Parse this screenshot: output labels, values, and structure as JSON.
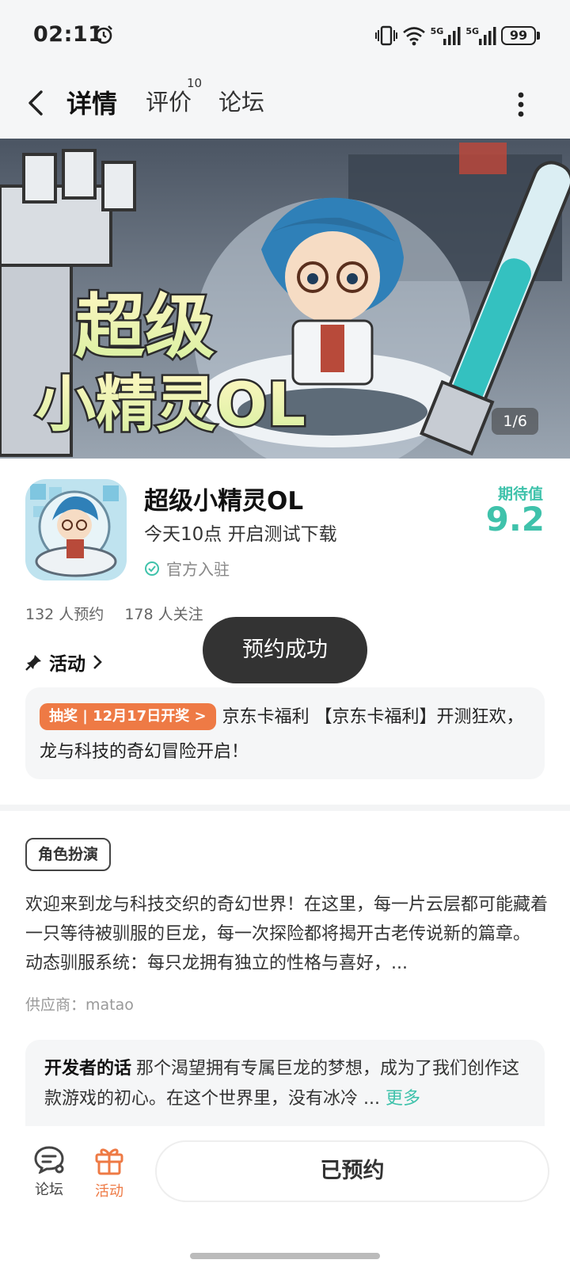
{
  "status_bar": {
    "time": "02:11",
    "network_label_1": "5G",
    "network_label_2": "5G",
    "battery": "99"
  },
  "nav": {
    "tabs": [
      {
        "label": "详情",
        "active": true
      },
      {
        "label": "评价",
        "badge": "10"
      },
      {
        "label": "论坛"
      }
    ]
  },
  "banner": {
    "title_line1": "超级",
    "title_line2": "小精灵OL",
    "counter": "1/6"
  },
  "app": {
    "name": "超级小精灵OL",
    "subtitle": "今天10点 开启测试下载",
    "official": "官方入驻",
    "score_label": "期待值",
    "score_value": "9.2",
    "reservations": "132 人预约",
    "followers": "178 人关注"
  },
  "activity": {
    "heading": "活动",
    "badge": "抽奖 | 12月17日开奖 >",
    "text": "京东卡福利 【京东卡福利】开测狂欢，龙与科技的奇幻冒险开启！"
  },
  "toast": "预约成功",
  "detail": {
    "genre": "角色扮演",
    "description": "欢迎来到龙与科技交织的奇幻世界！在这里，每一片云层都可能藏着一只等待被驯服的巨龙，每一次探险都将揭开古老传说新的篇章。 动态驯服系统：每只龙拥有独立的性格与喜好，...",
    "vendor": "供应商：matao",
    "dev_title": "开发者的话",
    "dev_text": "那个渴望拥有专属巨龙的梦想，成为了我们创作这款游戏的初心。在这个世界里，没有冰冷 ...",
    "dev_more": "更多"
  },
  "bottom": {
    "forum": "论坛",
    "activity": "活动",
    "reserved": "已预约"
  },
  "colors": {
    "accent": "#3fc2ab",
    "orange": "#ee7a45",
    "toast": "#333333"
  }
}
